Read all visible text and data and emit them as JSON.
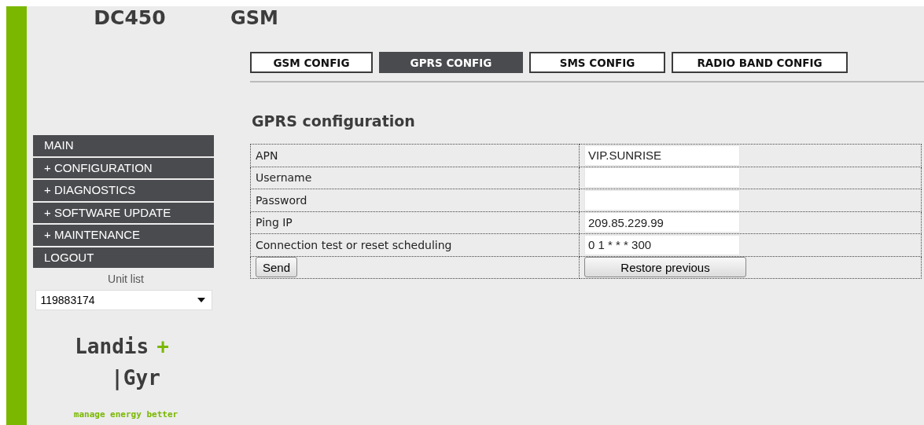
{
  "sidebar": {
    "title": "DC450",
    "menu": [
      {
        "label": "MAIN",
        "selected": false
      },
      {
        "label": "+ CONFIGURATION",
        "selected": false
      },
      {
        "label": "+ DIAGNOSTICS",
        "selected": false
      },
      {
        "label": "+ SOFTWARE UPDATE",
        "selected": false
      },
      {
        "label": "+ MAINTENANCE",
        "selected": false
      },
      {
        "label": "LOGOUT",
        "selected": false
      }
    ],
    "unit_list": {
      "label": "Unit list",
      "value": "119883174"
    },
    "logo": {
      "word1": "Landis",
      "plus": "+",
      "word2": "|Gyr",
      "tagline": "manage energy better"
    }
  },
  "page": {
    "title": "GSM",
    "tabs": [
      {
        "label": "GSM CONFIG",
        "selected": false
      },
      {
        "label": "GPRS CONFIG",
        "selected": true
      },
      {
        "label": "SMS CONFIG",
        "selected": false
      },
      {
        "label": "RADIO BAND CONFIG",
        "selected": false
      }
    ],
    "section_title": "GPRS configuration",
    "fields": [
      {
        "label": "APN",
        "value": "VIP.SUNRISE"
      },
      {
        "label": "Username"
      },
      {
        "label": "Password"
      },
      {
        "label": "Ping IP",
        "value": "209.85.229.99"
      },
      {
        "label": "Connection test or reset scheduling",
        "value": "0 1 * * * 300"
      }
    ],
    "buttons": {
      "send": "Send",
      "restore": "Restore previous"
    }
  }
}
